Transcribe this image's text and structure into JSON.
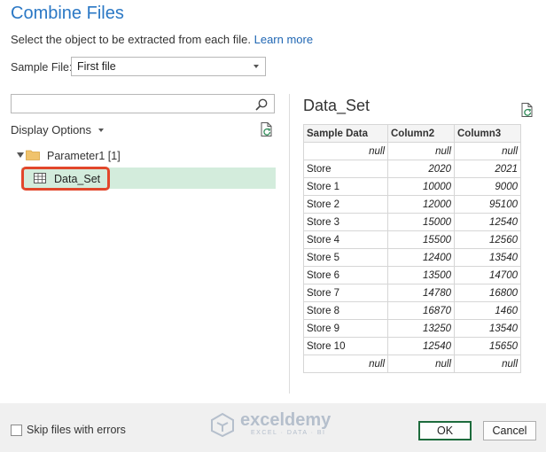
{
  "dialog": {
    "title": "Combine Files",
    "subtitle": "Select the object to be extracted from each file.",
    "learn_more": "Learn more"
  },
  "sample_file": {
    "label": "Sample File:",
    "value": "First file"
  },
  "search": {
    "placeholder": "",
    "icon": "search-icon"
  },
  "display_options": {
    "label": "Display Options"
  },
  "navigator": {
    "folder_label": "Parameter1 [1]",
    "selected_item": "Data_Set",
    "highlight_color": "#e2472b",
    "selected_bg": "#d3ecdc"
  },
  "preview": {
    "title": "Data_Set",
    "columns": [
      "Sample Data",
      "Column2",
      "Column3"
    ],
    "rows": [
      [
        "null",
        "null",
        "null"
      ],
      [
        "Store",
        "2020",
        "2021"
      ],
      [
        "Store 1",
        "10000",
        "9000"
      ],
      [
        "Store 2",
        "12000",
        "95100"
      ],
      [
        "Store 3",
        "15000",
        "12540"
      ],
      [
        "Store 4",
        "15500",
        "12560"
      ],
      [
        "Store 5",
        "12400",
        "13540"
      ],
      [
        "Store 6",
        "13500",
        "14700"
      ],
      [
        "Store 7",
        "14780",
        "16800"
      ],
      [
        "Store 8",
        "16870",
        "1460"
      ],
      [
        "Store 9",
        "13250",
        "13540"
      ],
      [
        "Store 10",
        "12540",
        "15650"
      ],
      [
        "null",
        "null",
        "null"
      ]
    ]
  },
  "footer": {
    "skip_label": "Skip files with errors",
    "ok_label": "OK",
    "cancel_label": "Cancel",
    "watermark": "exceldemy",
    "watermark_sub": "EXCEL · DATA · BI"
  },
  "colors": {
    "accent": "#2b78c5",
    "link": "#1f66b3",
    "ok_border": "#1d6b3c"
  }
}
